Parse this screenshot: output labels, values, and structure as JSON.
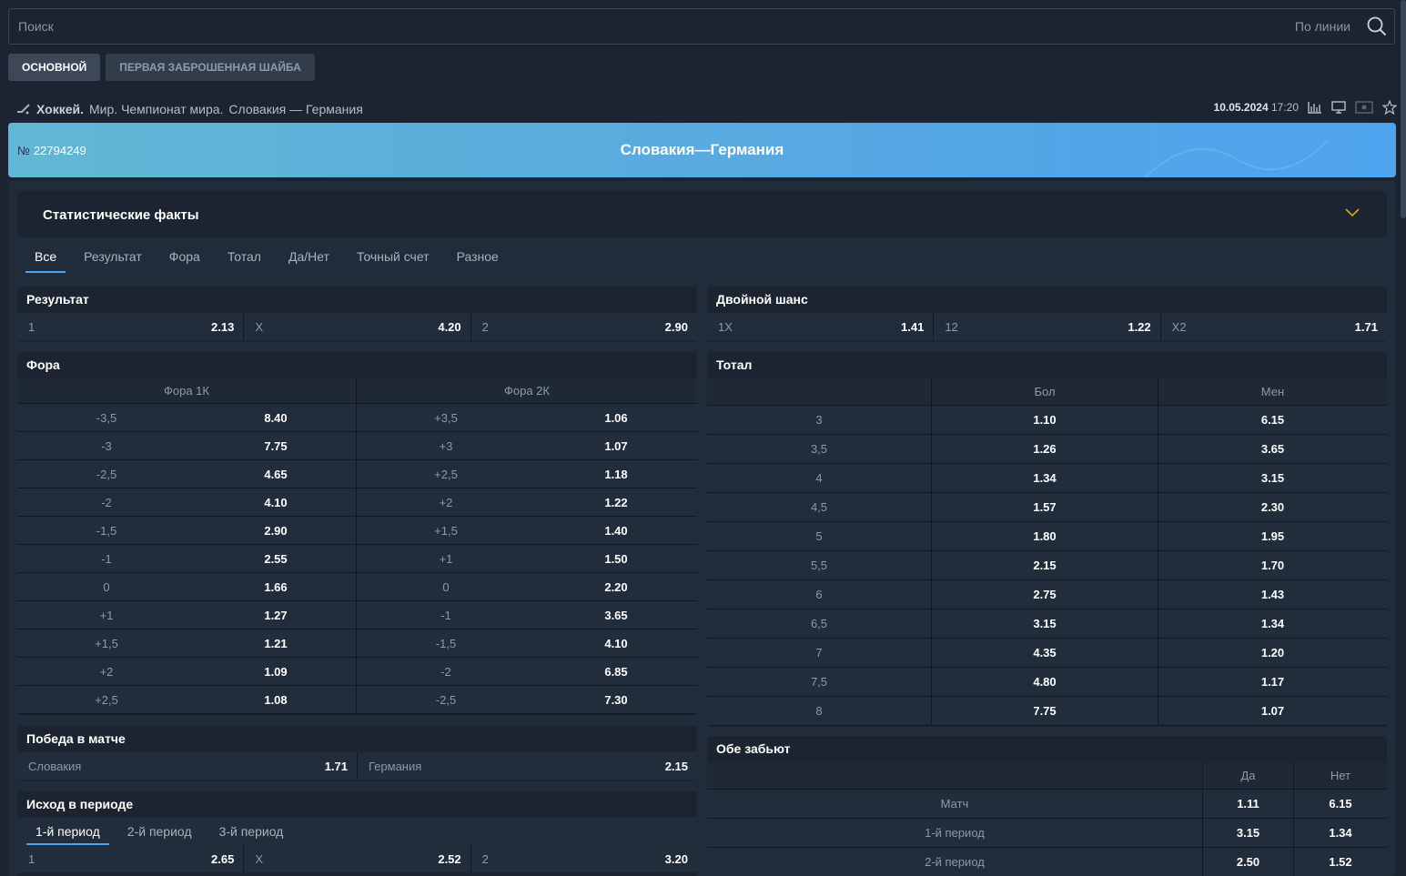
{
  "search": {
    "placeholder": "Поиск",
    "mode": "По линии"
  },
  "tabs": [
    "ОСНОВНОЙ",
    "ПЕРВАЯ ЗАБРОШЕННАЯ ШАЙБА"
  ],
  "breadcrumb": {
    "sport": "Хоккей.",
    "league": "Мир. Чемпионат мира.",
    "match": "Словакия — Германия"
  },
  "meta": {
    "date": "10.05.2024",
    "time": "17:20"
  },
  "banner": {
    "num_label": "№",
    "num": "22794249",
    "title": "Словакия—Германия"
  },
  "stat_title": "Статистические факты",
  "filters": [
    "Все",
    "Результат",
    "Фора",
    "Тотал",
    "Да/Нет",
    "Точный счет",
    "Разное"
  ],
  "result": {
    "title": "Результат",
    "cells": [
      [
        "1",
        "2.13"
      ],
      [
        "X",
        "4.20"
      ],
      [
        "2",
        "2.90"
      ]
    ]
  },
  "double": {
    "title": "Двойной шанс",
    "cells": [
      [
        "1X",
        "1.41"
      ],
      [
        "12",
        "1.22"
      ],
      [
        "X2",
        "1.71"
      ]
    ]
  },
  "handicap": {
    "title": "Фора",
    "col1": "Фора 1К",
    "col2": "Фора 2К",
    "rows": [
      [
        "-3,5",
        "8.40",
        "+3,5",
        "1.06"
      ],
      [
        "-3",
        "7.75",
        "+3",
        "1.07"
      ],
      [
        "-2,5",
        "4.65",
        "+2,5",
        "1.18"
      ],
      [
        "-2",
        "4.10",
        "+2",
        "1.22"
      ],
      [
        "-1,5",
        "2.90",
        "+1,5",
        "1.40"
      ],
      [
        "-1",
        "2.55",
        "+1",
        "1.50"
      ],
      [
        "0",
        "1.66",
        "0",
        "2.20"
      ],
      [
        "+1",
        "1.27",
        "-1",
        "3.65"
      ],
      [
        "+1,5",
        "1.21",
        "-1,5",
        "4.10"
      ],
      [
        "+2",
        "1.09",
        "-2",
        "6.85"
      ],
      [
        "+2,5",
        "1.08",
        "-2,5",
        "7.30"
      ]
    ]
  },
  "total": {
    "title": "Тотал",
    "over": "Бол",
    "under": "Мен",
    "rows": [
      [
        "3",
        "1.10",
        "6.15"
      ],
      [
        "3,5",
        "1.26",
        "3.65"
      ],
      [
        "4",
        "1.34",
        "3.15"
      ],
      [
        "4,5",
        "1.57",
        "2.30"
      ],
      [
        "5",
        "1.80",
        "1.95"
      ],
      [
        "5,5",
        "2.15",
        "1.70"
      ],
      [
        "6",
        "2.75",
        "1.43"
      ],
      [
        "6,5",
        "3.15",
        "1.34"
      ],
      [
        "7",
        "4.35",
        "1.20"
      ],
      [
        "7,5",
        "4.80",
        "1.17"
      ],
      [
        "8",
        "7.75",
        "1.07"
      ]
    ]
  },
  "win": {
    "title": "Победа в матче",
    "cells": [
      [
        "Словакия",
        "1.71"
      ],
      [
        "Германия",
        "2.15"
      ]
    ]
  },
  "both": {
    "title": "Обе забьют",
    "yes": "Да",
    "no": "Нет",
    "rows": [
      [
        "Матч",
        "1.11",
        "6.15"
      ],
      [
        "1-й период",
        "3.15",
        "1.34"
      ],
      [
        "2-й период",
        "2.50",
        "1.52"
      ]
    ]
  },
  "period": {
    "title": "Исход в периоде",
    "tabs": [
      "1-й период",
      "2-й период",
      "3-й период"
    ],
    "cells": [
      [
        "1",
        "2.65"
      ],
      [
        "X",
        "2.52"
      ],
      [
        "2",
        "3.20"
      ]
    ]
  }
}
